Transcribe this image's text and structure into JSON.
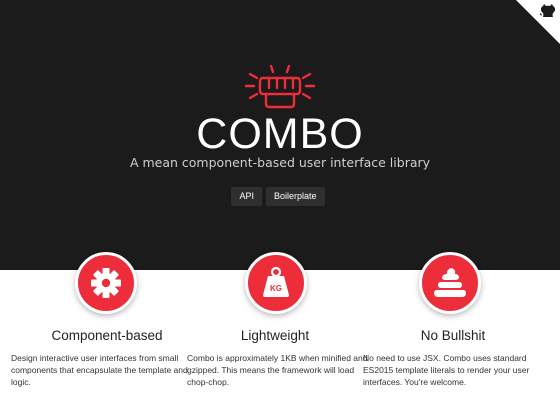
{
  "brand": {
    "title": "COMBO",
    "subtitle": "A mean component-based user interface library",
    "accent_color": "#ee2d3a",
    "hero_background": "#1b1b1b",
    "logo_icon": "punching-fist-icon"
  },
  "header": {
    "corner_icon": "github-octocat-icon"
  },
  "nav": {
    "buttons": [
      {
        "label": "API"
      },
      {
        "label": "Boilerplate"
      }
    ]
  },
  "features": [
    {
      "icon": "gear-icon",
      "title": "Component-based",
      "description": "Design interactive user interfaces from small components that encapsulate the template and logic."
    },
    {
      "icon": "weight-kg-icon",
      "icon_text": "KG",
      "title": "Lightweight",
      "description": "Combo is approximately 1KB when minified and gzipped. This means the framework will load chop-chop."
    },
    {
      "icon": "poop-icon",
      "title": "No Bullshit",
      "description": "No need to use JSX. Combo uses standard ES2015 template literals to render your user interfaces. You're welcome."
    }
  ]
}
